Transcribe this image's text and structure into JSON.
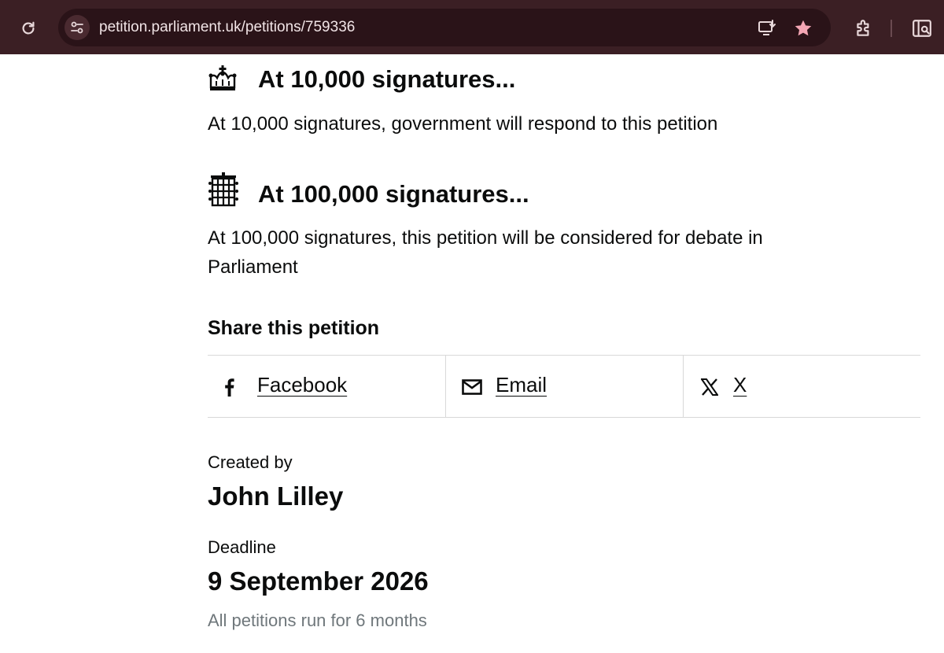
{
  "browser": {
    "url": "petition.parliament.uk/petitions/759336",
    "icons": [
      "reload-icon",
      "site-info-icon",
      "install-app-icon",
      "bookmark-star-icon",
      "extensions-icon",
      "side-panel-icon"
    ],
    "accent": "#f4a6b4"
  },
  "milestones": [
    {
      "icon": "crown-icon",
      "heading": "At 10,000 signatures...",
      "text": "At 10,000 signatures, government will respond to this petition"
    },
    {
      "icon": "portcullis-icon",
      "heading": "At 100,000 signatures...",
      "text": "At 100,000 signatures, this petition will be considered for debate in Parliament"
    }
  ],
  "share": {
    "title": "Share this petition",
    "options": [
      {
        "icon": "facebook-icon",
        "label": "Facebook"
      },
      {
        "icon": "email-icon",
        "label": "Email"
      },
      {
        "icon": "x-icon",
        "label": "X"
      }
    ]
  },
  "details": {
    "created_by_label": "Created by",
    "created_by_value": "John Lilley",
    "deadline_label": "Deadline",
    "deadline_value": "9 September 2026",
    "deadline_note": "All petitions run for 6 months"
  }
}
